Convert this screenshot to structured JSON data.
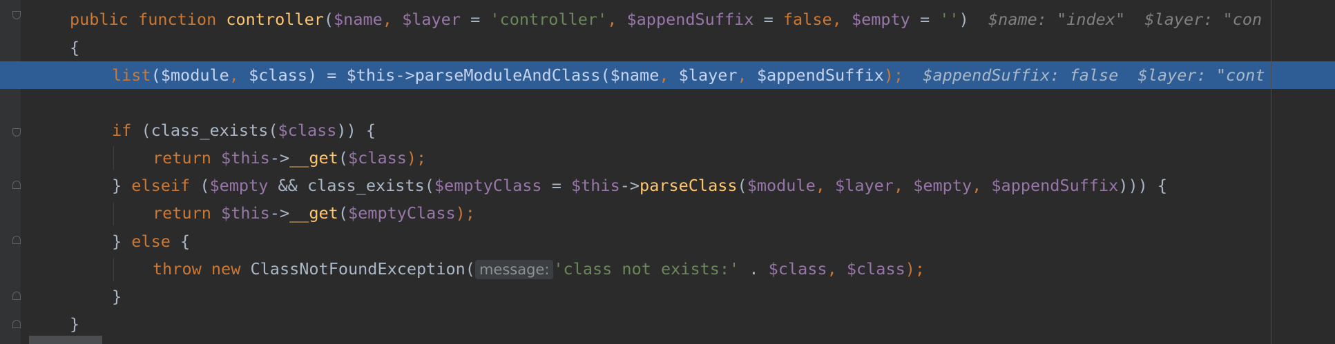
{
  "editor": {
    "lines": [
      {
        "tokens": [
          {
            "t": "public",
            "c": "k"
          },
          {
            "t": " ",
            "c": "p"
          },
          {
            "t": "function",
            "c": "k"
          },
          {
            "t": " ",
            "c": "p"
          },
          {
            "t": "controller",
            "c": "f"
          },
          {
            "t": "(",
            "c": "p"
          },
          {
            "t": "$name",
            "c": "v"
          },
          {
            "t": ", ",
            "c": "k"
          },
          {
            "t": "$layer",
            "c": "v"
          },
          {
            "t": " = ",
            "c": "p"
          },
          {
            "t": "'controller'",
            "c": "s"
          },
          {
            "t": ", ",
            "c": "k"
          },
          {
            "t": "$appendSuffix",
            "c": "v"
          },
          {
            "t": " = ",
            "c": "p"
          },
          {
            "t": "false",
            "c": "k"
          },
          {
            "t": ", ",
            "c": "k"
          },
          {
            "t": "$empty",
            "c": "v"
          },
          {
            "t": " = ",
            "c": "p"
          },
          {
            "t": "''",
            "c": "s"
          },
          {
            "t": ")",
            "c": "p"
          },
          {
            "t": "  $name: \"index\"  $layer: \"con",
            "c": "h"
          }
        ]
      },
      {
        "tokens": [
          {
            "t": "{",
            "c": "p"
          }
        ]
      },
      {
        "current": true,
        "tokens": [
          {
            "t": "list",
            "c": "k"
          },
          {
            "t": "(",
            "c": "p"
          },
          {
            "t": "$module",
            "c": "v"
          },
          {
            "t": ", ",
            "c": "k"
          },
          {
            "t": "$class",
            "c": "v"
          },
          {
            "t": ") = ",
            "c": "p"
          },
          {
            "t": "$this",
            "c": "v"
          },
          {
            "t": "->",
            "c": "p"
          },
          {
            "t": "parseModuleAndClass",
            "c": "f"
          },
          {
            "t": "(",
            "c": "p"
          },
          {
            "t": "$name",
            "c": "v"
          },
          {
            "t": ", ",
            "c": "k"
          },
          {
            "t": "$layer",
            "c": "v"
          },
          {
            "t": ", ",
            "c": "k"
          },
          {
            "t": "$appendSuffix",
            "c": "v"
          },
          {
            "t": ");",
            "c": "k"
          },
          {
            "t": "  $appendSuffix: false  $layer: \"cont",
            "c": "x"
          }
        ]
      },
      {
        "tokens": []
      },
      {
        "tokens": [
          {
            "t": "if",
            "c": "k"
          },
          {
            "t": " (",
            "c": "p"
          },
          {
            "t": "class_exists",
            "c": "t"
          },
          {
            "t": "(",
            "c": "p"
          },
          {
            "t": "$class",
            "c": "v"
          },
          {
            "t": ")) {",
            "c": "p"
          }
        ]
      },
      {
        "tokens": [
          {
            "t": "return",
            "c": "k"
          },
          {
            "t": " ",
            "c": "p"
          },
          {
            "t": "$this",
            "c": "v"
          },
          {
            "t": "->",
            "c": "p"
          },
          {
            "t": "__get",
            "c": "f"
          },
          {
            "t": "(",
            "c": "p"
          },
          {
            "t": "$class",
            "c": "v"
          },
          {
            "t": ");",
            "c": "k"
          }
        ]
      },
      {
        "tokens": [
          {
            "t": "} ",
            "c": "p"
          },
          {
            "t": "elseif",
            "c": "k"
          },
          {
            "t": " (",
            "c": "p"
          },
          {
            "t": "$empty",
            "c": "v"
          },
          {
            "t": " && ",
            "c": "p"
          },
          {
            "t": "class_exists",
            "c": "t"
          },
          {
            "t": "(",
            "c": "p"
          },
          {
            "t": "$emptyClass",
            "c": "v"
          },
          {
            "t": " = ",
            "c": "p"
          },
          {
            "t": "$this",
            "c": "v"
          },
          {
            "t": "->",
            "c": "p"
          },
          {
            "t": "parseClass",
            "c": "f"
          },
          {
            "t": "(",
            "c": "p"
          },
          {
            "t": "$module",
            "c": "v"
          },
          {
            "t": ", ",
            "c": "k"
          },
          {
            "t": "$layer",
            "c": "v"
          },
          {
            "t": ", ",
            "c": "k"
          },
          {
            "t": "$empty",
            "c": "v"
          },
          {
            "t": ", ",
            "c": "k"
          },
          {
            "t": "$appendSuffix",
            "c": "v"
          },
          {
            "t": "))) {",
            "c": "p"
          }
        ]
      },
      {
        "tokens": [
          {
            "t": "return",
            "c": "k"
          },
          {
            "t": " ",
            "c": "p"
          },
          {
            "t": "$this",
            "c": "v"
          },
          {
            "t": "->",
            "c": "p"
          },
          {
            "t": "__get",
            "c": "f"
          },
          {
            "t": "(",
            "c": "p"
          },
          {
            "t": "$emptyClass",
            "c": "v"
          },
          {
            "t": ");",
            "c": "k"
          }
        ]
      },
      {
        "tokens": [
          {
            "t": "} ",
            "c": "p"
          },
          {
            "t": "else",
            "c": "k"
          },
          {
            "t": " {",
            "c": "p"
          }
        ]
      },
      {
        "tokens": [
          {
            "t": "throw",
            "c": "k"
          },
          {
            "t": " ",
            "c": "p"
          },
          {
            "t": "new",
            "c": "k"
          },
          {
            "t": " ",
            "c": "p"
          },
          {
            "t": "ClassNotFoundException",
            "c": "t"
          },
          {
            "t": "(",
            "c": "p"
          },
          {
            "t": "message:",
            "c": "i"
          },
          {
            "t": "'class not exists:'",
            "c": "s"
          },
          {
            "t": " . ",
            "c": "p"
          },
          {
            "t": "$class",
            "c": "v"
          },
          {
            "t": ", ",
            "c": "k"
          },
          {
            "t": "$class",
            "c": "v"
          },
          {
            "t": ");",
            "c": "k"
          }
        ]
      },
      {
        "tokens": [
          {
            "t": "}",
            "c": "p"
          }
        ]
      },
      {
        "tokens": [
          {
            "t": "}",
            "c": "p"
          }
        ]
      }
    ]
  },
  "colors": {
    "background": "#2b2b2b",
    "gutter": "#313335",
    "current_line": "#2d5d94",
    "keyword": "#cc7832",
    "function": "#ffc66d",
    "variable": "#9876aa",
    "string": "#6a8759",
    "plain": "#a9b7c6",
    "inline_hint": "#808080"
  }
}
